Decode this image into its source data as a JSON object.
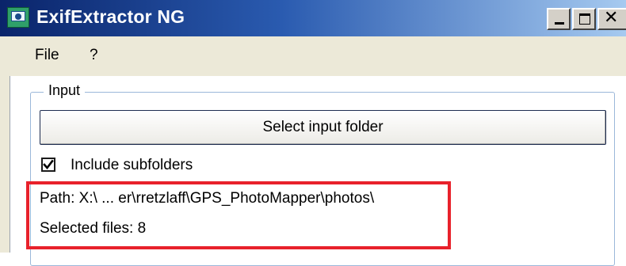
{
  "window": {
    "title": "ExifExtractor NG",
    "icon": "app-camera-icon",
    "controls": [
      "minimize-icon",
      "maximize-icon",
      "close-icon"
    ]
  },
  "menu": {
    "items": [
      {
        "label": "File"
      },
      {
        "label": "?"
      }
    ]
  },
  "input_group": {
    "legend": "Input",
    "select_button_label": "Select input folder",
    "include_subfolders_label": "Include subfolders",
    "include_subfolders_checked": true,
    "path_text": "Path: X:\\ ... er\\rretzlaff\\GPS_PhotoMapper\\photos\\",
    "selected_files_text": "Selected files: 8"
  },
  "colors": {
    "titlebar_start": "#0a246a",
    "titlebar_end": "#a6caf0",
    "highlight": "#e8212b",
    "group_border": "#9bb7d9"
  }
}
